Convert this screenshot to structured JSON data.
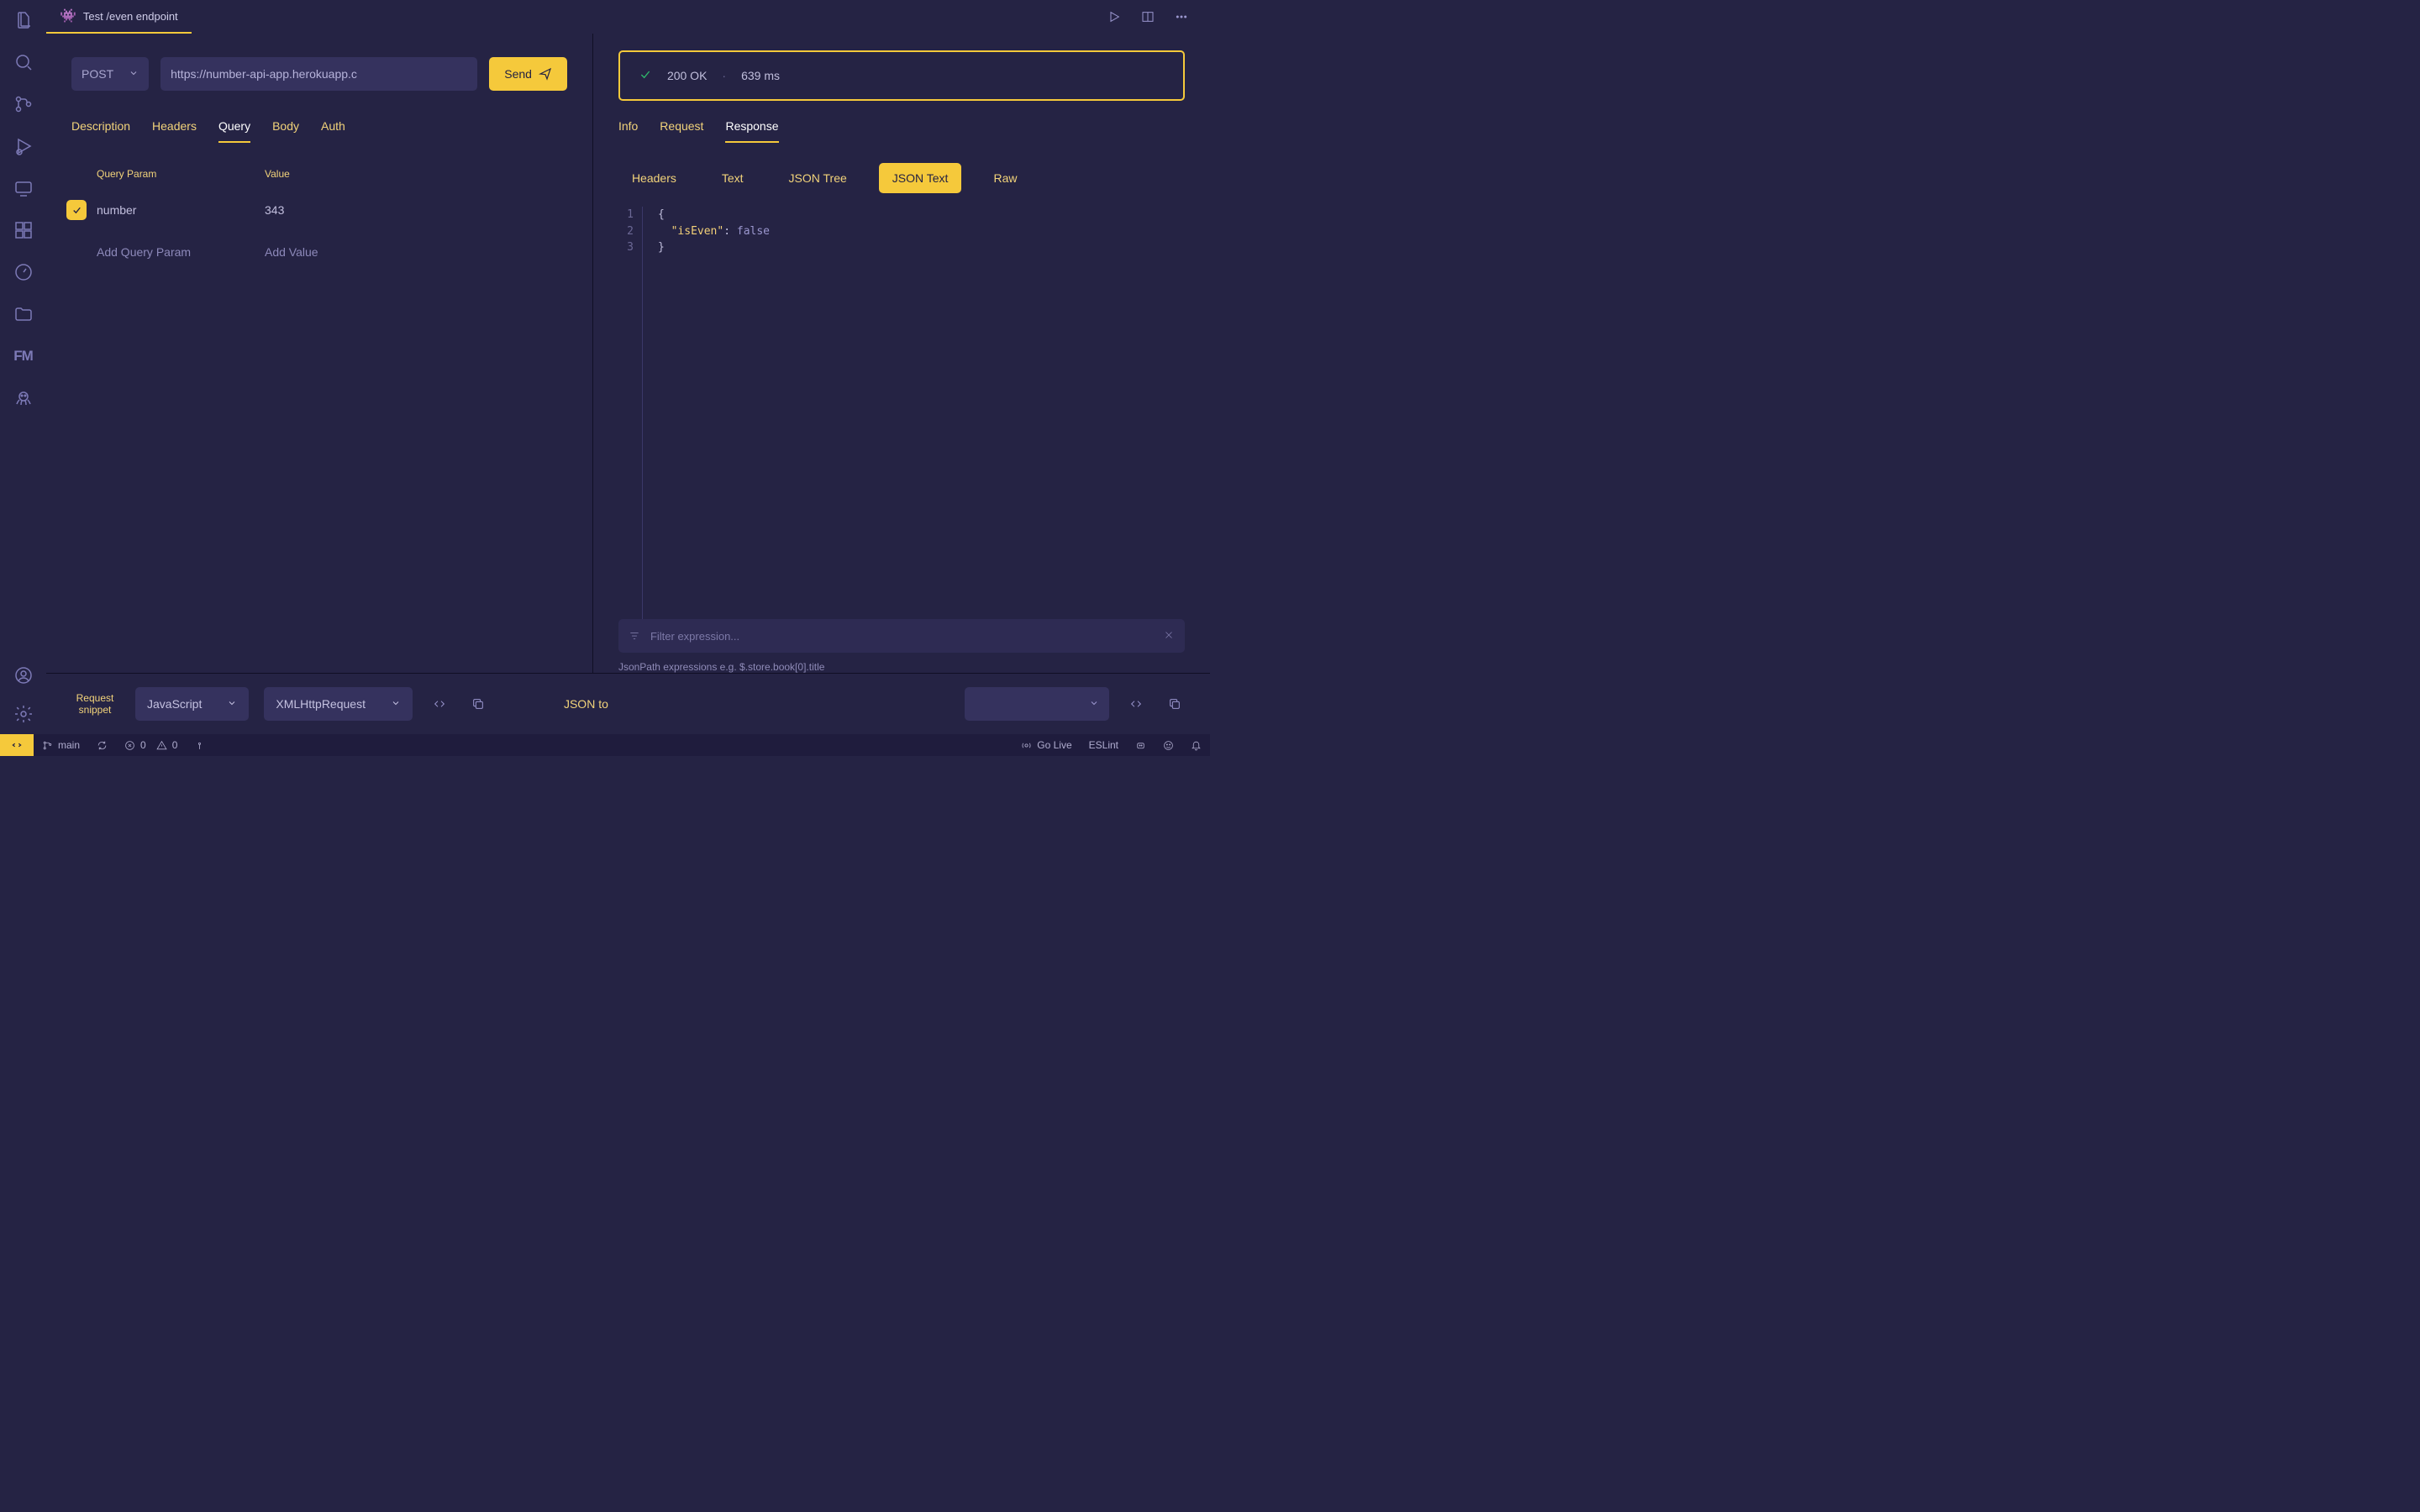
{
  "tab": {
    "title": "Test /even endpoint"
  },
  "request": {
    "method": "POST",
    "url": "https://number-api-app.herokuapp.c",
    "send_label": "Send",
    "tabs": [
      "Description",
      "Headers",
      "Query",
      "Body",
      "Auth"
    ],
    "active_tab": "Query",
    "query_table": {
      "head_param": "Query Param",
      "head_value": "Value",
      "rows": [
        {
          "enabled": true,
          "param": "number",
          "value": "343"
        }
      ],
      "add_param": "Add Query Param",
      "add_value": "Add Value"
    },
    "snippet_label": "Request\nsnippet",
    "snippet_lang": "JavaScript",
    "snippet_client": "XMLHttpRequest"
  },
  "response": {
    "status_code": "200 OK",
    "time": "639 ms",
    "tabs": [
      "Info",
      "Request",
      "Response"
    ],
    "active_tab": "Response",
    "sub_tabs": [
      "Headers",
      "Text",
      "JSON Tree",
      "JSON Text",
      "Raw"
    ],
    "active_sub": "JSON Text",
    "json_lines": [
      {
        "n": "1",
        "html": "<span class='brace'>{</span>"
      },
      {
        "n": "2",
        "html": "&nbsp;&nbsp;<span class='key'>\"isEven\"</span><span class='punc'>: </span><span class='bool'>false</span>"
      },
      {
        "n": "3",
        "html": "<span class='brace'>}</span>"
      }
    ],
    "filter_placeholder": "Filter expression...",
    "filter_hint": "JsonPath expressions e.g. $.store.book[0].title",
    "json_to_label": "JSON to"
  },
  "statusbar": {
    "branch": "main",
    "errors": "0",
    "warnings": "0",
    "golive": "Go Live",
    "eslint": "ESLint"
  }
}
